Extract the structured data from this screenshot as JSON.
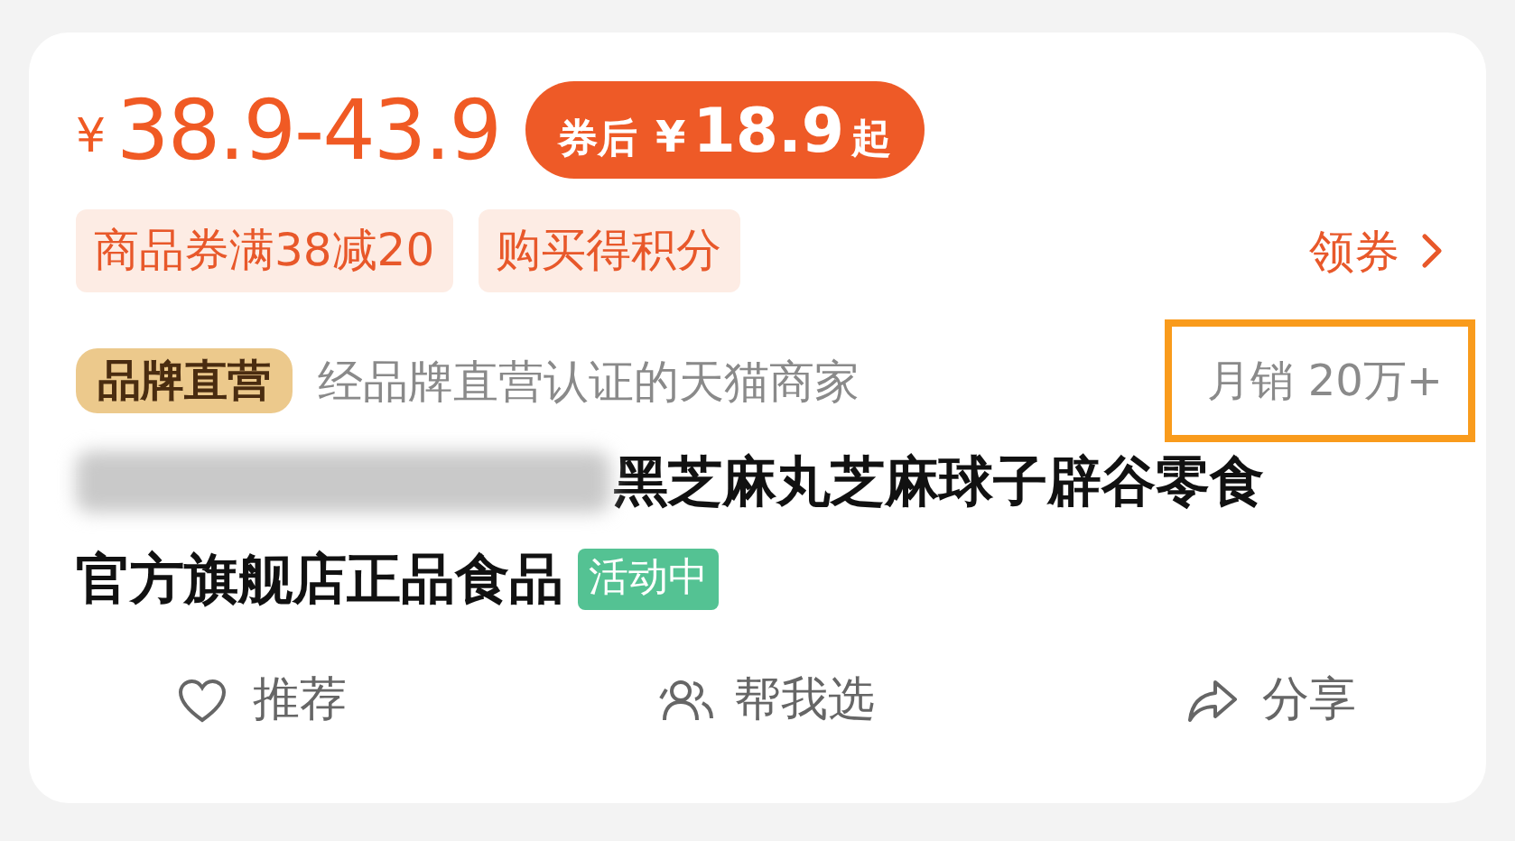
{
  "price": {
    "currency": "¥",
    "range": "38.9-43.9"
  },
  "coupon_price": {
    "prefix": "券后",
    "currency": "¥",
    "amount": "18.9",
    "suffix": "起"
  },
  "promo_tags": [
    {
      "label": "商品券满38减20"
    },
    {
      "label": "购买得积分"
    }
  ],
  "coupon_link": {
    "label": "领券"
  },
  "brand": {
    "badge": "品牌直营",
    "description": "经品牌直营认证的天猫商家"
  },
  "monthly_sales": {
    "text": "月销 20万+",
    "highlighted": true
  },
  "title": {
    "redacted": true,
    "lines": [
      "黑芝麻丸芝麻球子辟谷零食",
      "官方旗舰店正品食品"
    ],
    "status_tag": "活动中"
  },
  "actions": [
    {
      "kind": "recommend",
      "label": "推荐"
    },
    {
      "kind": "help-choose",
      "label": "帮我选"
    },
    {
      "kind": "share",
      "label": "分享"
    }
  ]
}
